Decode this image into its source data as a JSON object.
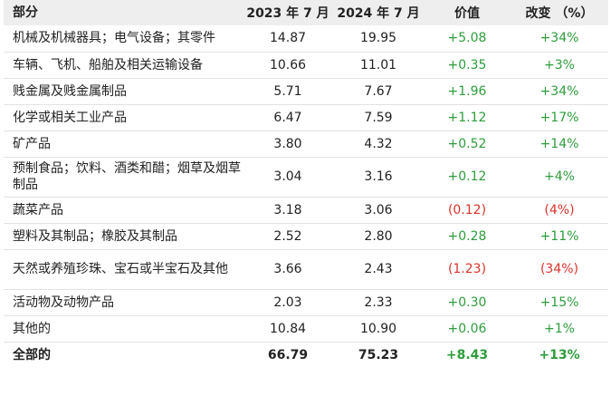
{
  "table": {
    "headers": [
      "部分",
      "2023 年 7 月",
      "2024 年 7 月",
      "价值",
      "改变 （%）"
    ],
    "rows": [
      {
        "name": "机械及机械器具；电气设备；其零件",
        "y2023": "14.87",
        "y2024": "19.95",
        "value": "+5.08",
        "change": "+34%",
        "sign": "pos"
      },
      {
        "name": "车辆、飞机、船舶及相关运输设备",
        "y2023": "10.66",
        "y2024": "11.01",
        "value": "+0.35",
        "change": "+3%",
        "sign": "pos"
      },
      {
        "name": "贱金属及贱金属制品",
        "y2023": "5.71",
        "y2024": "7.67",
        "value": "+1.96",
        "change": "+34%",
        "sign": "pos"
      },
      {
        "name": "化学或相关工业产品",
        "y2023": "6.47",
        "y2024": "7.59",
        "value": "+1.12",
        "change": "+17%",
        "sign": "pos"
      },
      {
        "name": "矿产品",
        "y2023": "3.80",
        "y2024": "4.32",
        "value": "+0.52",
        "change": "+14%",
        "sign": "pos"
      },
      {
        "name": "预制食品；饮料、酒类和醋；烟草及烟草制品",
        "y2023": "3.04",
        "y2024": "3.16",
        "value": "+0.12",
        "change": "+4%",
        "sign": "pos"
      },
      {
        "name": "蔬菜产品",
        "y2023": "3.18",
        "y2024": "3.06",
        "value": "(0.12)",
        "change": "(4%)",
        "sign": "neg"
      },
      {
        "name": "塑料及其制品；橡胶及其制品",
        "y2023": "2.52",
        "y2024": "2.80",
        "value": "+0.28",
        "change": "+11%",
        "sign": "pos"
      },
      {
        "name": "天然或养殖珍珠、宝石或半宝石及其他",
        "y2023": "3.66",
        "y2024": "2.43",
        "value": "(1.23)",
        "change": "(34%)",
        "sign": "neg"
      },
      {
        "name": "活动物及动物产品",
        "y2023": "2.03",
        "y2024": "2.33",
        "value": "+0.30",
        "change": "+15%",
        "sign": "pos"
      },
      {
        "name": "其他的",
        "y2023": "10.84",
        "y2024": "10.90",
        "value": "+0.06",
        "change": "+1%",
        "sign": "pos"
      },
      {
        "name": "全部的",
        "y2023": "66.79",
        "y2024": "75.23",
        "value": "+8.43",
        "change": "+13%",
        "sign": "pos"
      }
    ]
  }
}
